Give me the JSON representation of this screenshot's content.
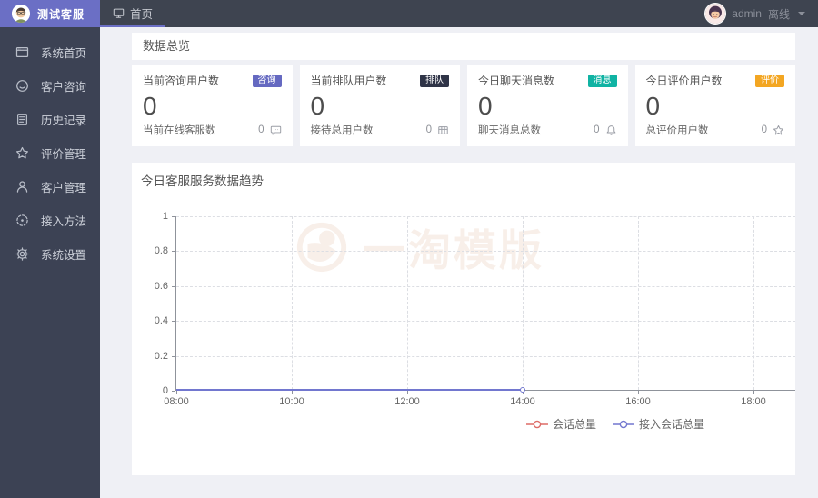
{
  "app": {
    "brand": "测试客服"
  },
  "topbar": {
    "home_tab": "首页",
    "user_name": "admin",
    "user_status": "离线"
  },
  "sidebar": {
    "items": [
      {
        "label": "系统首页",
        "icon": "window-icon"
      },
      {
        "label": "客户咨询",
        "icon": "smiley-icon"
      },
      {
        "label": "历史记录",
        "icon": "history-doc-icon"
      },
      {
        "label": "评价管理",
        "icon": "star-icon"
      },
      {
        "label": "客户管理",
        "icon": "user-icon"
      },
      {
        "label": "接入方法",
        "icon": "dashed-circle-icon"
      },
      {
        "label": "系统设置",
        "icon": "gear-icon"
      }
    ]
  },
  "overview": {
    "title": "数据总览",
    "cards": [
      {
        "title": "当前咨询用户数",
        "badge": "咨询",
        "badge_color": "#6569c1",
        "value": "0",
        "sub_label": "当前在线客服数",
        "sub_value": "0",
        "icon": "chat-bubble-icon"
      },
      {
        "title": "当前排队用户数",
        "badge": "排队",
        "badge_color": "#2f3447",
        "value": "0",
        "sub_label": "接待总用户数",
        "sub_value": "0",
        "icon": "grid-icon"
      },
      {
        "title": "今日聊天消息数",
        "badge": "消息",
        "badge_color": "#10b3a3",
        "value": "0",
        "sub_label": "聊天消息总数",
        "sub_value": "0",
        "icon": "bell-icon"
      },
      {
        "title": "今日评价用户数",
        "badge": "评价",
        "badge_color": "#f3a622",
        "value": "0",
        "sub_label": "总评价用户数",
        "sub_value": "0",
        "icon": "star-icon"
      }
    ]
  },
  "chart_data": {
    "type": "line",
    "title": "今日客服服务数据趋势",
    "x_ticks": [
      "08:00",
      "10:00",
      "12:00",
      "14:00",
      "16:00",
      "18:00"
    ],
    "y_ticks": [
      "1",
      "0.8",
      "0.6",
      "0.4",
      "0.2",
      "0"
    ],
    "ylim": [
      0,
      1
    ],
    "grid": "dashed",
    "legend_position": "bottom",
    "watermark": "一淘模版",
    "series": [
      {
        "name": "会话总量",
        "color": "#dd6b66",
        "x": [],
        "values": []
      },
      {
        "name": "接入会话总量",
        "color": "#7277cf",
        "x": [
          "08:00",
          "09:00",
          "10:00",
          "11:00",
          "12:00",
          "13:00",
          "14:00"
        ],
        "values": [
          0,
          0,
          0,
          0,
          0,
          0,
          0
        ]
      }
    ]
  }
}
